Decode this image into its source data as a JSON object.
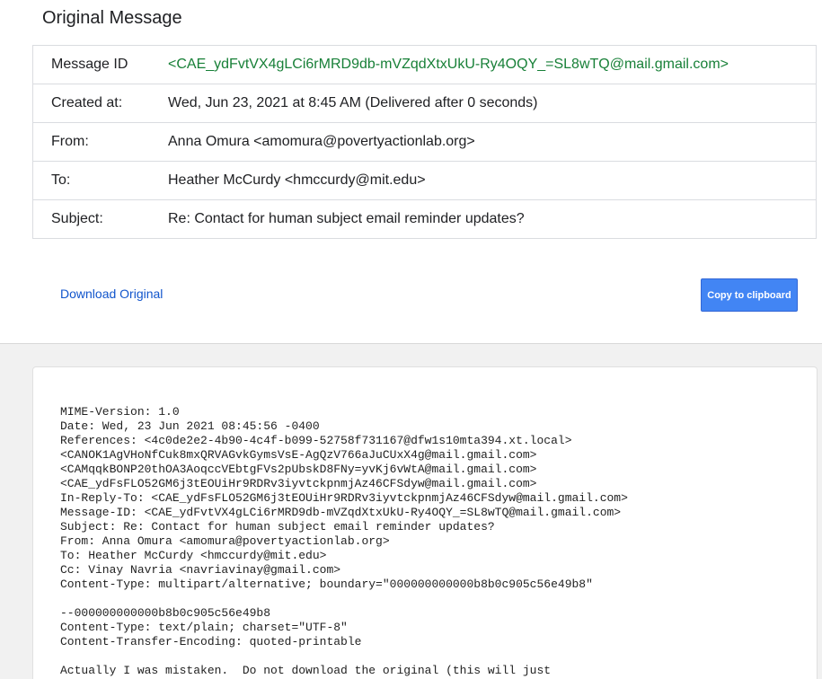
{
  "page": {
    "title": "Original Message"
  },
  "details": [
    {
      "label": "Message ID",
      "value": "<CAE_ydFvtVX4gLCi6rMRD9db-mVZqdXtxUkU-Ry4OQY_=SL8wTQ@mail.gmail.com>"
    },
    {
      "label": "Created at:",
      "value": "Wed, Jun 23, 2021 at 8:45 AM (Delivered after 0 seconds)"
    },
    {
      "label": "From:",
      "value": "Anna Omura <amomura@povertyactionlab.org>"
    },
    {
      "label": "To:",
      "value": "Heather McCurdy <hmccurdy@mit.edu>"
    },
    {
      "label": "Subject:",
      "value": "Re: Contact for human subject email reminder updates?"
    }
  ],
  "actions": {
    "download_label": "Download Original",
    "copy_label": "Copy to clipboard"
  },
  "raw_lines": [
    "MIME-Version: 1.0",
    "Date: Wed, 23 Jun 2021 08:45:56 -0400",
    "References: <4c0de2e2-4b90-4c4f-b099-52758f731167@dfw1s10mta394.xt.local>",
    "<CANOK1AgVHoNfCuk8mxQRVAGvkGymsVsE-AgQzV766aJuCUxX4g@mail.gmail.com>",
    "<CAMqqkBONP20thOA3AoqccVEbtgFVs2pUbskD8FNy=yvKj6vWtA@mail.gmail.com>",
    "<CAE_ydFsFLO52GM6j3tEOUiHr9RDRv3iyvtckpnmjAz46CFSdyw@mail.gmail.com>",
    "In-Reply-To: <CAE_ydFsFLO52GM6j3tEOUiHr9RDRv3iyvtckpnmjAz46CFSdyw@mail.gmail.com>",
    "Message-ID: <CAE_ydFvtVX4gLCi6rMRD9db-mVZqdXtxUkU-Ry4OQY_=SL8wTQ@mail.gmail.com>",
    "Subject: Re: Contact for human subject email reminder updates?",
    "From: Anna Omura <amomura@povertyactionlab.org>",
    "To: Heather McCurdy <hmccurdy@mit.edu>",
    "Cc: Vinay Navria <navriavinay@gmail.com>",
    "Content-Type: multipart/alternative; boundary=\"000000000000b8b0c905c56e49b8\"",
    "",
    "--000000000000b8b0c905c56e49b8",
    "Content-Type: text/plain; charset=\"UTF-8\"",
    "Content-Transfer-Encoding: quoted-printable",
    "",
    "Actually I was mistaken.  Do not download the original (this will just"
  ]
}
